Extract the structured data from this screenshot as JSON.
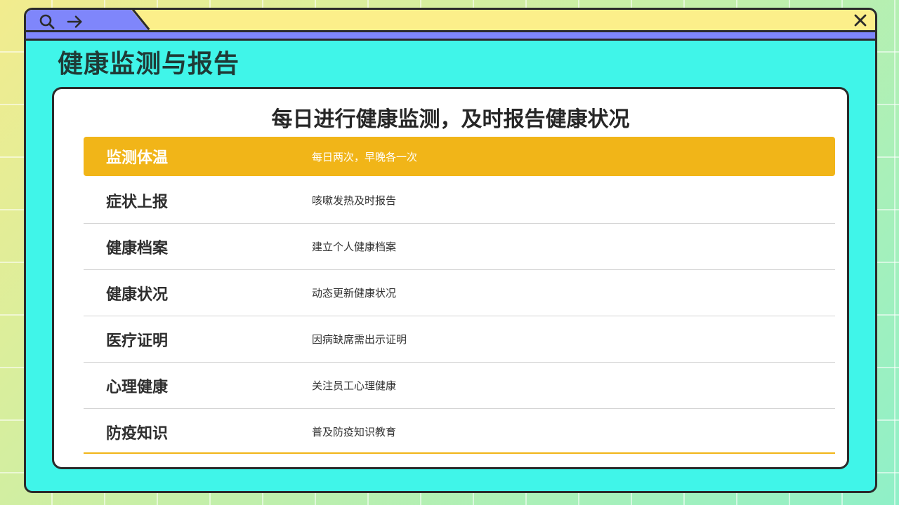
{
  "window": {
    "search_icon": "search-icon",
    "forward_icon": "arrow-right-icon",
    "close_icon": "close-icon"
  },
  "page_title": "健康监测与报告",
  "card_heading": "每日进行健康监测，及时报告健康状况",
  "rows": [
    {
      "label": "监测体温",
      "desc": "每日两次，早晚各一次",
      "highlighted": true
    },
    {
      "label": "症状上报",
      "desc": "咳嗽发热及时报告",
      "highlighted": false
    },
    {
      "label": "健康档案",
      "desc": "建立个人健康档案",
      "highlighted": false
    },
    {
      "label": "健康状况",
      "desc": "动态更新健康状况",
      "highlighted": false
    },
    {
      "label": "医疗证明",
      "desc": "因病缺席需出示证明",
      "highlighted": false
    },
    {
      "label": "心理健康",
      "desc": "关注员工心理健康",
      "highlighted": false
    },
    {
      "label": "防疫知识",
      "desc": "普及防疫知识教育",
      "highlighted": false
    }
  ],
  "colors": {
    "titlebar": "#fcef8a",
    "tab": "#7f86fb",
    "window_bg": "#40f5e9",
    "highlight": "#f1b518",
    "outline": "#2b2b2b"
  }
}
